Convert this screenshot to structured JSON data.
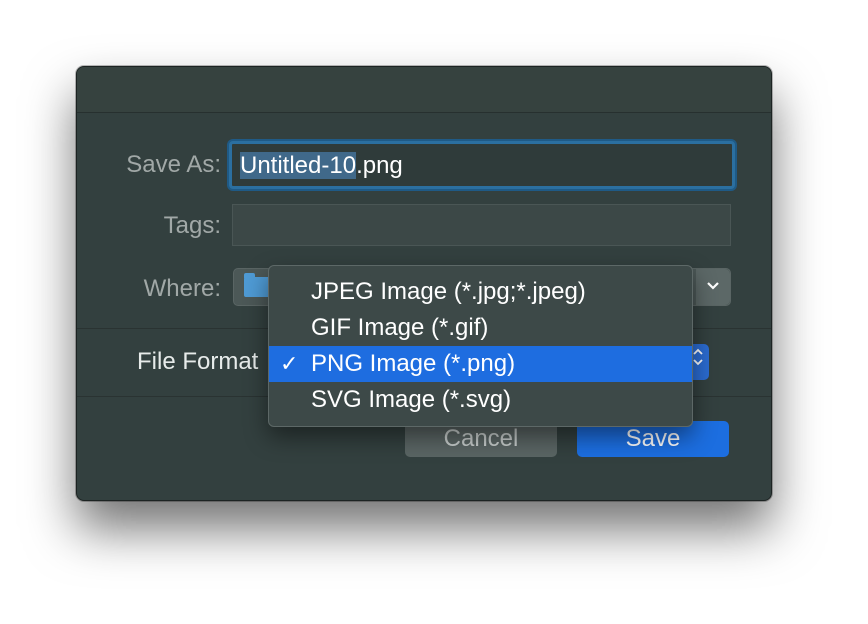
{
  "dialog": {
    "save_as_label": "Save As:",
    "filename_selected": "Untitled-10",
    "filename_extension": ".png",
    "tags_label": "Tags:",
    "where_label": "Where:",
    "file_format_label": "File Format",
    "cancel_label": "Cancel",
    "save_label": "Save",
    "icons": {
      "where_icon": "folder-icon",
      "where_chevron": "chevron-down-icon",
      "format_stepper": "up-down-arrows-icon",
      "selected_mark": "checkmark-icon"
    }
  },
  "format_menu": {
    "items": [
      {
        "label": "JPEG Image (*.jpg;*.jpeg)",
        "selected": false,
        "check": ""
      },
      {
        "label": "GIF Image (*.gif)",
        "selected": false,
        "check": ""
      },
      {
        "label": "PNG Image (*.png)",
        "selected": true,
        "check": "✓"
      },
      {
        "label": "SVG Image (*.svg)",
        "selected": false,
        "check": ""
      }
    ]
  },
  "colors": {
    "dialog_bg": "#33403f",
    "accent_blue": "#1e6de0",
    "focus_ring": "#2b6fa0"
  }
}
